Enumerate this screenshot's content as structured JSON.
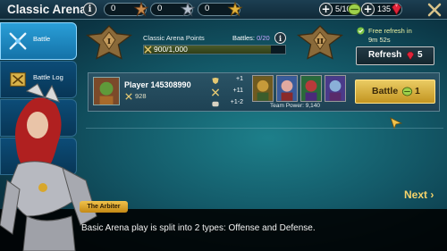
{
  "header": {
    "title": "Classic Arena",
    "info": "i",
    "tokens": [
      {
        "value": "0",
        "icon": "bronze-medal-icon",
        "color": "#c98b4d"
      },
      {
        "value": "0",
        "icon": "silver-medal-icon",
        "color": "#b8c2cf"
      },
      {
        "value": "0",
        "icon": "gold-medal-icon",
        "color": "#e3b43b"
      }
    ],
    "arena_tokens": "5/10",
    "energy": "135",
    "close": "close-icon"
  },
  "sidebar": {
    "items": [
      {
        "label": "Battle",
        "icon": "crossed-swords-icon",
        "active": true
      },
      {
        "label": "Battle Log",
        "icon": "battle-log-icon",
        "active": false
      }
    ]
  },
  "arena": {
    "current_tier": "I",
    "next_tier": "II",
    "points_label": "Classic Arena Points",
    "points_value": "900/1,000",
    "battles_label": "Battles:",
    "battles_value": "0/20",
    "refresh_note_line1": "Free refresh in",
    "refresh_note_line2": "9m 52s",
    "refresh_button": "Refresh",
    "refresh_cost": "5"
  },
  "opponent": {
    "name": "Player 145308990",
    "power": "928",
    "stats": [
      {
        "icon": "shield-icon",
        "value": "+1"
      },
      {
        "icon": "swords-icon",
        "value": "+11"
      },
      {
        "icon": "scroll-icon",
        "value": "+1-2"
      }
    ],
    "team_power_label": "Team Power: 9,140",
    "battle_button": "Battle",
    "battle_cost": "1"
  },
  "tutorial": {
    "speaker": "The Arbiter",
    "text": "Basic Arena play is split into 2 types: Offense and Defense.",
    "next": "Next ›"
  }
}
